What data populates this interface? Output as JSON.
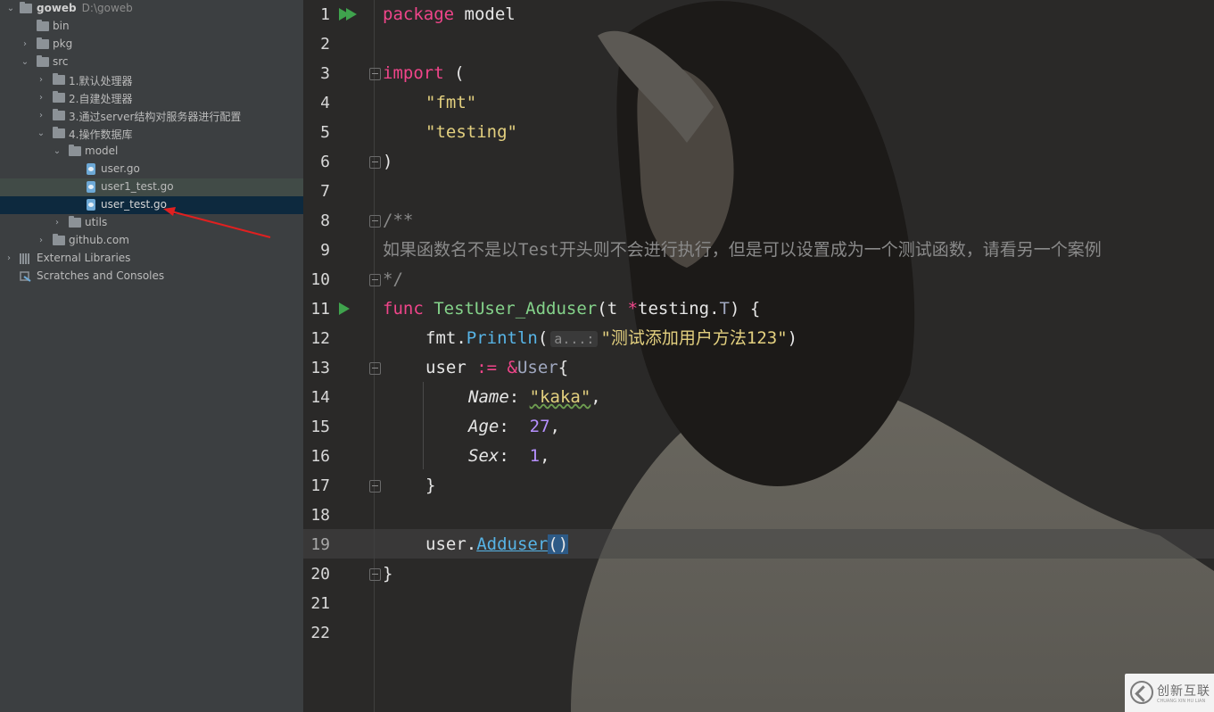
{
  "project_tree": {
    "root": {
      "name": "goweb",
      "path": "D:\\goweb"
    },
    "items": [
      {
        "label": "bin"
      },
      {
        "label": "pkg"
      },
      {
        "label": "src"
      },
      {
        "label": "1.默认处理器"
      },
      {
        "label": "2.自建处理器"
      },
      {
        "label": "3.通过server结构对服务器进行配置"
      },
      {
        "label": "4.操作数据库"
      },
      {
        "label": "model"
      },
      {
        "label": "user.go"
      },
      {
        "label": "user1_test.go"
      },
      {
        "label": "user_test.go"
      },
      {
        "label": "utils"
      },
      {
        "label": "github.com"
      },
      {
        "label": "External Libraries"
      },
      {
        "label": "Scratches and Consoles"
      }
    ]
  },
  "editor": {
    "line_numbers": [
      "1",
      "2",
      "3",
      "4",
      "5",
      "6",
      "7",
      "8",
      "9",
      "10",
      "11",
      "12",
      "13",
      "14",
      "15",
      "16",
      "17",
      "18",
      "19",
      "20",
      "21",
      "22"
    ],
    "current_line": 19,
    "code": {
      "l1_kw": "package",
      "l1_rest": " model",
      "l3_kw": "import",
      "l3_rest": " (",
      "l4": "\"fmt\"",
      "l5": "\"testing\"",
      "l6": ")",
      "l8": "/**",
      "l9": "如果函数名不是以Test开头则不会进行执行，但是可以设置成为一个测试函数，请看另一个案例",
      "l10": "*/",
      "l11_kw": "func",
      "l11_fn": "TestUser_Adduser",
      "l11_a": "(t ",
      "l11_ptr": "*",
      "l11_b": "testing.",
      "l11_T": "T",
      "l11_c": ") {",
      "l12_a": "fmt.",
      "l12_call": "Println",
      "l12_paren": "(",
      "l12_hint": "a...:",
      "l12_str": "\"测试添加用户方法123\"",
      "l12_end": ")",
      "l13_a": "user ",
      "l13_op": ":=",
      "l13_amp": " &",
      "l13_type": "User",
      "l13_end": "{",
      "l14_field": "Name",
      "l14_colon": ": ",
      "l14_str": "\"kaka\"",
      "l14_end": ",",
      "l15_field": "Age",
      "l15_colon": ":  ",
      "l15_num": "27",
      "l15_end": ",",
      "l16_field": "Sex",
      "l16_colon": ":  ",
      "l16_num": "1",
      "l16_end": ",",
      "l17": "}",
      "l19_a": "user.",
      "l19_call": "Adduser",
      "l19_end": "()",
      "l20": "}"
    }
  },
  "watermark": {
    "text": "创新互联",
    "sub": "CHUANG XIN HU LIAN"
  }
}
